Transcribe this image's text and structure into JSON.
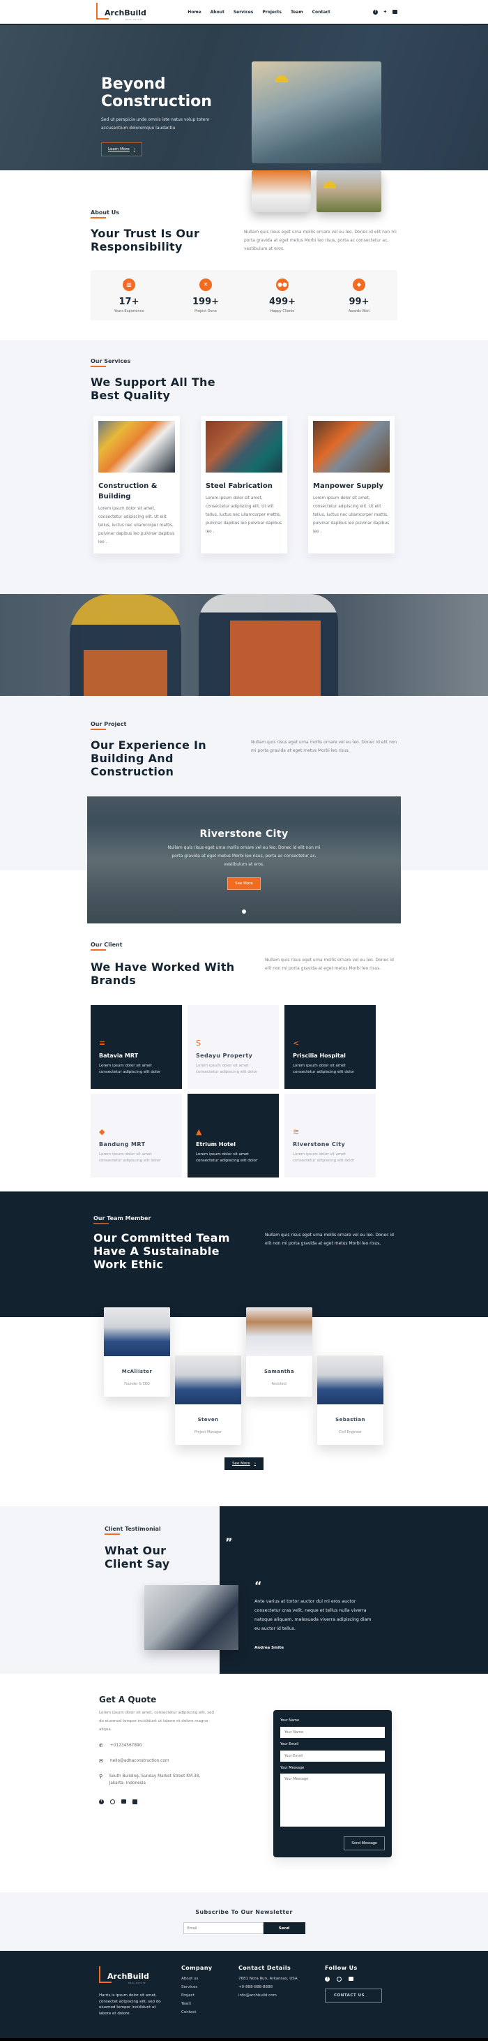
{
  "brand": {
    "name": "ArchBuild",
    "tagline": "REAL ESTATE",
    "accent": "#f26b21",
    "navy": "#13222f"
  },
  "nav": {
    "items": [
      "Home",
      "About",
      "Services",
      "Projects",
      "Team",
      "Contact"
    ],
    "social": [
      "facebook-icon",
      "twitter-icon",
      "youtube-icon"
    ]
  },
  "hero": {
    "title": "Beyond Construction",
    "subtitle": "Sed ut perspicia unde omnis iste natus volup totem accusantium doloremque laudantiu",
    "button": "Learn More"
  },
  "about": {
    "eyebrow": "About Us",
    "title": "Your Trust Is Our Responsibility",
    "text": "Nullam quis risus eget urna mollis ornare vel eu leo. Donec id elit non mi porta gravida at eget metus Morbi leo risus, porta ac consectetur ac, vestibulum at eros.",
    "stats": [
      {
        "icon": "building-icon",
        "value": "17+",
        "label": "Years Experience"
      },
      {
        "icon": "tools-icon",
        "value": "199+",
        "label": "Project Done"
      },
      {
        "icon": "users-icon",
        "value": "499+",
        "label": "Happy Clients"
      },
      {
        "icon": "diamond-icon",
        "value": "99+",
        "label": "Awards Won"
      }
    ]
  },
  "services": {
    "eyebrow": "Our Services",
    "title": "We Support All The Best Quality",
    "items": [
      {
        "title": "Construction & Building",
        "text": "Lorem ipsum dolor sit amet, consectetur adipiscing elit. Ut elit tellus, luctus nec ullamcorper mattis, pulvinar dapibus leo pulvinar dapibus leo ."
      },
      {
        "title": "Steel Fabrication",
        "text": "Lorem ipsum dolor sit amet, consectetur adipiscing elit. Ut elit tellus, luctus nec ullamcorper mattis, pulvinar dapibus leo pulvinar dapibus leo ."
      },
      {
        "title": "Manpower Supply",
        "text": "Lorem ipsum dolor sit amet, consectetur adipiscing elit. Ut elit tellus, luctus nec ullamcorper mattis, pulvinar dapibus leo pulvinar dapibus leo ."
      }
    ]
  },
  "projects": {
    "eyebrow": "Our Project",
    "title": "Our Experience In Building And Construction",
    "text": "Nullam quis risus eget urna mollis ornare vel eu leo. Donec id elit non mi porta gravida at eget metus Morbi leo risus.",
    "slide": {
      "title": "Riverstone City",
      "text": "Nullam quis risus eget urna mollis ornare vel eu leo. Donec id elit non mi porta gravida at eget metus Morbi leo risus, porta ac consectetur ac, vestibulum at eros.",
      "button": "See More"
    }
  },
  "clients": {
    "eyebrow": "Our Client",
    "title": "We Have Worked With Brands",
    "text": "Nullam quis risus eget urna mollis ornare vel eu leo. Donec id elit non mi porta gravida at eget metus Morbi leo risus.",
    "brands": [
      {
        "name": "Batavia MRT",
        "icon": "≡",
        "text": "Lorem ipsum dolor sit amet consectetur adipiscing elit dolor"
      },
      {
        "name": "Sedayu Property",
        "icon": "S",
        "text": "Lorem ipsum dolor sit amet consectetur adipiscing elit dolor"
      },
      {
        "name": "Priscilia Hospital",
        "icon": "<",
        "text": "Lorem ipsum dolor sit amet consectetur adipiscing elit dolor"
      },
      {
        "name": "Bandung MRT",
        "icon": "◆",
        "text": "Lorem ipsum dolor sit amet consectetur adipiscing elit dolor"
      },
      {
        "name": "Etrium Hotel",
        "icon": "▲",
        "text": "Lorem ipsum dolor sit amet consectetur adipiscing elit dolor"
      },
      {
        "name": "Riverstone City",
        "icon": "≋",
        "text": "Lorem ipsum dolor sit amet consectetur adipiscing elit dolor"
      }
    ]
  },
  "team": {
    "eyebrow": "Our Team Member",
    "title": "Our Committed Team Have A Sustainable Work Ethic",
    "text": "Nullam quis risus eget urna mollis ornare vel eu leo. Donec id elit non mi porta gravida at eget metus Morbi leo risus,",
    "members": [
      {
        "name": "McAllister",
        "role": "Founder & CEO"
      },
      {
        "name": "Steven",
        "role": "Project Manager"
      },
      {
        "name": "Samantha",
        "role": "Architect"
      },
      {
        "name": "Sebastian",
        "role": "Civil Engineer"
      }
    ],
    "button": "See More"
  },
  "testimonial": {
    "eyebrow": "Client Testimonial",
    "title": "What Our Client Say",
    "quote": "Ante varius at tortor auctor dui mi eros auctor consectetur cras velit, neque et tellus nulla viverra natoque aliquam, malesuada viverra adipiscing diam eu auctor id tellus.",
    "author": "Andrea Smite"
  },
  "quote": {
    "title": "Get A Quote",
    "text": "Lorem ipsum dolor sit amet, consectetur adipiscing elit, sed do eiusmod tempor incididunt ut labore et dolore magna aliqua.",
    "phone": "+01234567890",
    "email": "hello@adhaconstruction.com",
    "address": "South Building, Sunday Market Street KM.38, Jakarta- Indonesia",
    "form": {
      "name_label": "Your Name",
      "name_placeholder": "Your Name",
      "email_label": "Your Email",
      "email_placeholder": "Your Email",
      "message_label": "Your Message",
      "message_placeholder": "Your Message",
      "submit": "Send Message"
    }
  },
  "newsletter": {
    "title": "Subscribe To Our Newsletter",
    "placeholder": "Email",
    "button": "Send"
  },
  "footer": {
    "about": "Harris is ipsum dolor sit amet, consectet adipiscing elit, sed do eiusmod tempor incididunt ut labore et dolore",
    "company_title": "Company",
    "company_links": [
      "About us",
      "Services",
      "Project",
      "Team",
      "Contact"
    ],
    "contact_title": "Contact Details",
    "address": "7681 Nora Run, Arkansas, USA",
    "phone": "+0-888-888-8888",
    "email": "info@archbuild.com",
    "follow_title": "Follow Us",
    "contact_button": "CONTACT US"
  }
}
